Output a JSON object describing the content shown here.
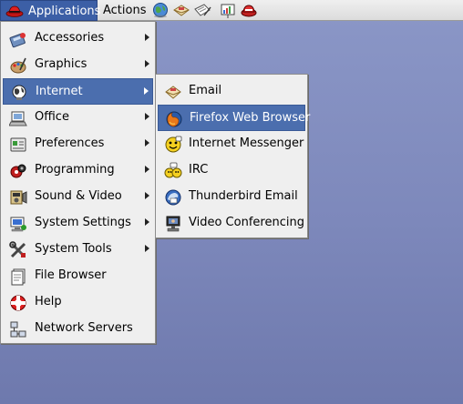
{
  "panel": {
    "applications_label": "Applications",
    "actions_label": "Actions",
    "launchers": [
      "web-browser-icon",
      "email-icon",
      "writer-icon",
      "presentation-icon",
      "print-icon"
    ]
  },
  "main_menu": {
    "items": [
      {
        "label": "Accessories",
        "icon": "accessories-icon",
        "has_submenu": true
      },
      {
        "label": "Graphics",
        "icon": "graphics-icon",
        "has_submenu": true
      },
      {
        "label": "Internet",
        "icon": "internet-icon",
        "has_submenu": true,
        "selected": true
      },
      {
        "label": "Office",
        "icon": "office-icon",
        "has_submenu": true
      },
      {
        "label": "Preferences",
        "icon": "preferences-icon",
        "has_submenu": true
      },
      {
        "label": "Programming",
        "icon": "programming-icon",
        "has_submenu": true
      },
      {
        "label": "Sound & Video",
        "icon": "sound-video-icon",
        "has_submenu": true
      },
      {
        "label": "System Settings",
        "icon": "system-settings-icon",
        "has_submenu": true
      },
      {
        "label": "System Tools",
        "icon": "system-tools-icon",
        "has_submenu": true
      },
      {
        "label": "File Browser",
        "icon": "file-browser-icon",
        "has_submenu": false
      },
      {
        "label": "Help",
        "icon": "help-icon",
        "has_submenu": false
      },
      {
        "label": "Network Servers",
        "icon": "network-servers-icon",
        "has_submenu": false
      }
    ]
  },
  "internet_submenu": {
    "items": [
      {
        "label": "Email",
        "icon": "email-icon"
      },
      {
        "label": "Firefox Web Browser",
        "icon": "firefox-icon",
        "selected": true
      },
      {
        "label": "Internet Messenger",
        "icon": "messenger-icon"
      },
      {
        "label": "IRC",
        "icon": "irc-icon"
      },
      {
        "label": "Thunderbird Email",
        "icon": "thunderbird-icon"
      },
      {
        "label": "Video Conferencing",
        "icon": "video-conferencing-icon"
      }
    ]
  },
  "colors": {
    "selection": "#4b6eae",
    "panel_button": "#3c5fa6",
    "desktop": "#7d88bb",
    "menu_bg": "#efefef"
  }
}
